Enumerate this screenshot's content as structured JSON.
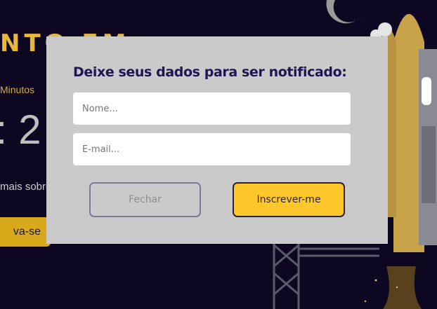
{
  "background": {
    "title_fragment": "NTO EM",
    "minutes_label": "Minutos",
    "timer_fragment": ": 2",
    "more_text_fragment": "mais sobre",
    "cta_fragment": "va-se"
  },
  "modal": {
    "title": "Deixe seus dados para ser notificado:",
    "name_placeholder": "Nome...",
    "email_placeholder": "E-mail...",
    "close_label": "Fechar",
    "subscribe_label": "Inscrever-me"
  },
  "colors": {
    "background": "#0d0722",
    "modal": "#cacaca",
    "accent": "#fdc72b",
    "title": "#1d1554"
  }
}
